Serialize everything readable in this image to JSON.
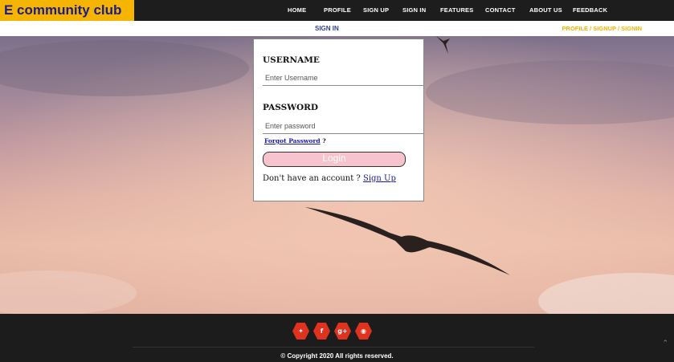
{
  "brand": "E community club",
  "nav": [
    "HOME",
    "PROFILE",
    "SIGN UP",
    "SIGN IN",
    "FEATURES",
    "CONTACT",
    "ABOUT US",
    "FEEDBACK"
  ],
  "subbar": {
    "title": "SIGN IN",
    "breadcrumb": "PROFILE / SIGNUP / SIGNIN"
  },
  "form": {
    "username_label": "USERNAME",
    "username_placeholder": "Enter Username",
    "password_label": "PASSWORD",
    "password_placeholder": "Enter password",
    "forgot_label": "Forgot Password",
    "forgot_suffix": " ?",
    "login_label": "Login",
    "no_account_text": "Don't have an account ?",
    "signup_link": "Sign Up"
  },
  "footer": {
    "social_icons": [
      "twitter-icon",
      "facebook-icon",
      "google-plus-icon",
      "pinterest-icon"
    ],
    "social_glyphs": [
      "✦",
      "f",
      "g+",
      "◉"
    ],
    "copyright": "© Copyright 2020   All rights reserved."
  },
  "colors": {
    "brand_bg": "#f4b400",
    "brand_text": "#1b1b8f",
    "accent": "#e0331f",
    "login_button": "#f7c3cd"
  }
}
